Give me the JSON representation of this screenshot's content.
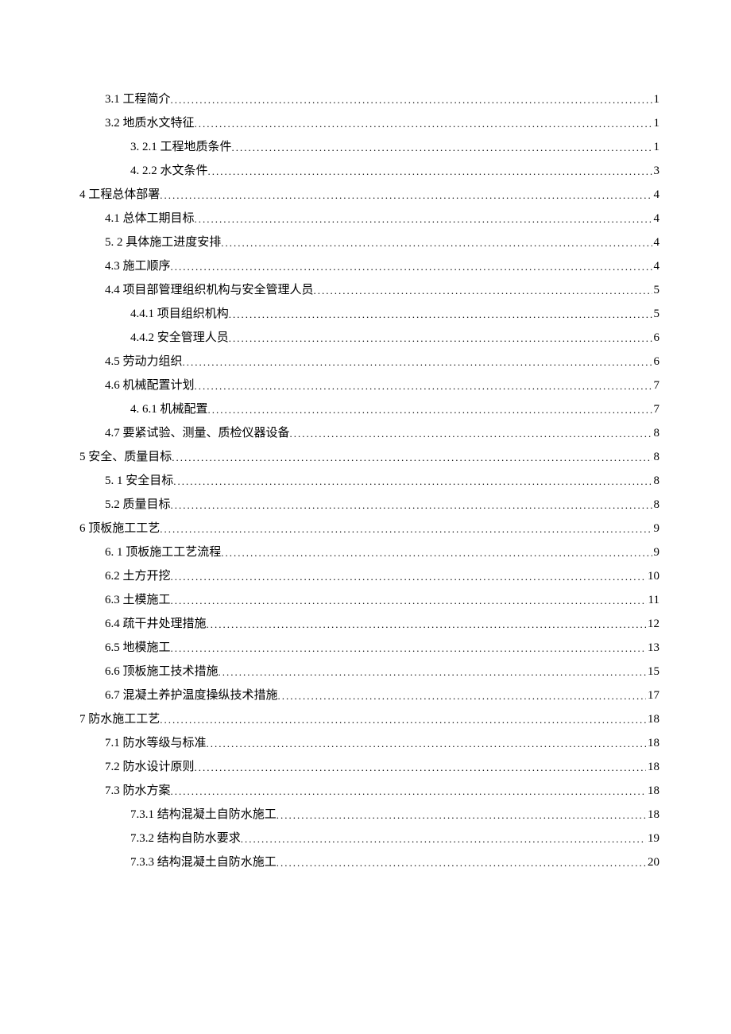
{
  "toc": [
    {
      "lv": 1,
      "label": "3.1 工程简介",
      "page": "1"
    },
    {
      "lv": 1,
      "label": "3.2 地质水文特征",
      "page": "1"
    },
    {
      "lv": 2,
      "label": "3. 2.1 工程地质条件",
      "page": "1"
    },
    {
      "lv": 2,
      "label": "4. 2.2 水文条件",
      "page": "3"
    },
    {
      "lv": 0,
      "label": "4 工程总体部署",
      "page": "4"
    },
    {
      "lv": 1,
      "label": "4.1  总体工期目标",
      "page": "4"
    },
    {
      "lv": 1,
      "label": "5. 2 具体施工进度安排",
      "page": "4"
    },
    {
      "lv": 1,
      "label": "4.3 施工顺序",
      "page": "4"
    },
    {
      "lv": 1,
      "label": "4.4 项目部管理组织机构与安全管理人员",
      "page": "5"
    },
    {
      "lv": 2,
      "label": "4.4.1 项目组织机构",
      "page": "5"
    },
    {
      "lv": 2,
      "label": "4.4.2 安全管理人员",
      "page": "6"
    },
    {
      "lv": 1,
      "label": "4.5 劳动力组织",
      "page": "6"
    },
    {
      "lv": 1,
      "label": "4.6 机械配置计划",
      "page": "7"
    },
    {
      "lv": 2,
      "label": "4. 6.1 机械配置",
      "page": "7"
    },
    {
      "lv": 1,
      "label": "4.7 要紧试验、测量、质检仪器设备",
      "page": "8"
    },
    {
      "lv": 0,
      "label": "5 安全、质量目标",
      "page": "8"
    },
    {
      "lv": 1,
      "label": "5. 1 安全目标",
      "page": "8"
    },
    {
      "lv": 1,
      "label": "5.2 质量目标",
      "page": "8"
    },
    {
      "lv": 0,
      "label": "6 顶板施工工艺",
      "page": "9"
    },
    {
      "lv": 1,
      "label": "6. 1 顶板施工工艺流程",
      "page": "9"
    },
    {
      "lv": 1,
      "label": "6.2 土方开挖",
      "page": "10"
    },
    {
      "lv": 1,
      "label": "6.3 土模施工",
      "page": "11"
    },
    {
      "lv": 1,
      "label": "6.4 疏干井处理措施",
      "page": "12"
    },
    {
      "lv": 1,
      "label": "6.5 地模施工",
      "page": "13"
    },
    {
      "lv": 1,
      "label": "6.6 顶板施工技术措施",
      "page": "15"
    },
    {
      "lv": 1,
      "label": "6.7 混凝土养护温度操纵技术措施",
      "page": "17"
    },
    {
      "lv": 0,
      "label": "7 防水施工工艺",
      "page": "18"
    },
    {
      "lv": 1,
      "label": "7.1 防水等级与标准",
      "page": "18"
    },
    {
      "lv": 1,
      "label": "7.2 防水设计原则",
      "page": "18"
    },
    {
      "lv": 1,
      "label": "7.3 防水方案",
      "page": "18"
    },
    {
      "lv": 2,
      "label": "7.3.1 结构混凝土自防水施工",
      "page": "18"
    },
    {
      "lv": 2,
      "label": "7.3.2 结构自防水要求",
      "page": "19"
    },
    {
      "lv": 2,
      "label": "7.3.3 结构混凝土自防水施工",
      "page": "20"
    }
  ]
}
